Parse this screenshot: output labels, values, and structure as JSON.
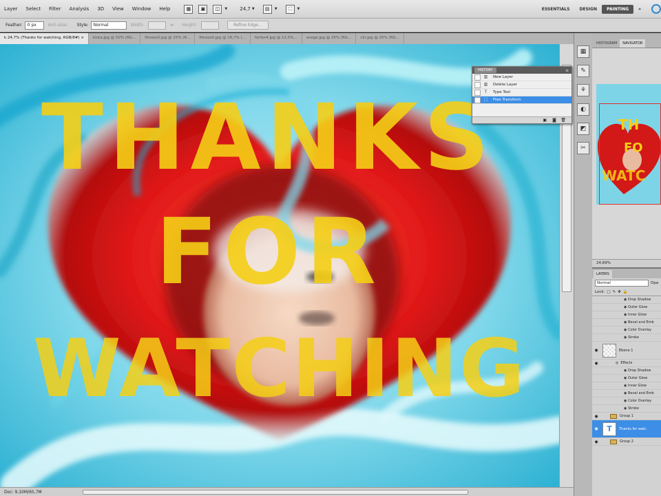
{
  "menu": [
    "Layer",
    "Select",
    "Filter",
    "Analysis",
    "3D",
    "View",
    "Window",
    "Help"
  ],
  "toolbar": {
    "zoom": "24,7"
  },
  "workspaces": [
    "ESSENTIALS",
    "DESIGN",
    "PAINTING"
  ],
  "active_workspace": "PAINTING",
  "options_bar": {
    "feather_label": "Feather:",
    "feather_value": "0 px",
    "anti_alias": "Anti-alias",
    "style_label": "Style:",
    "style_value": "Normal",
    "width_label": "Width:",
    "height_label": "Height:",
    "refine_edge": "Refine Edge..."
  },
  "document_tabs": [
    "k 24,7% (Thanks for watching, RGB/8#) ×",
    "kiota.jpg @ 50% (RG...",
    "fitness0.jpg @ 25% (R...",
    "fitness0.jpg @ 16,7% (...",
    "fortkn4.jpg @ 12,5%...",
    "avege.jpg @ 25% (RG...",
    "cln.jpg @ 25% (RG..."
  ],
  "canvas_text": {
    "line1": "THANKS",
    "line2": "FOR",
    "line3": "WATCHING"
  },
  "colors": {
    "text_yellow": "#f5cf16",
    "heart_red": "#d81616",
    "sky_cyan": "#6ecbe0",
    "selection_blue": "#3d8ee6"
  },
  "history": {
    "tab": "HISTORY",
    "items": [
      {
        "label": "New Layer",
        "icon": "layer-icon",
        "active": false
      },
      {
        "label": "Delete Layer",
        "icon": "layer-icon",
        "active": false
      },
      {
        "label": "Type Tool",
        "icon": "type-icon",
        "active": false
      },
      {
        "label": "Free Transform",
        "icon": "transform-icon",
        "active": true
      }
    ]
  },
  "navigator": {
    "tabs": [
      "HISTOGRAM",
      "NAVIGATOR"
    ],
    "active_tab": "NAVIGATOR",
    "zoom": "24,69%"
  },
  "layers_panel": {
    "tab": "LAYERS",
    "blend_mode": "Normal",
    "opacity_label": "Opa",
    "lock_label": "Lock:",
    "rows": [
      {
        "kind": "fx",
        "label": "Drop Shadow"
      },
      {
        "kind": "fx",
        "label": "Outer Glow"
      },
      {
        "kind": "fx",
        "label": "Inner Glow"
      },
      {
        "kind": "fx",
        "label": "Bevel and Emb"
      },
      {
        "kind": "fx",
        "label": "Color Overlay"
      },
      {
        "kind": "fx",
        "label": "Stroke"
      },
      {
        "kind": "layer",
        "label": "Ebene 1"
      },
      {
        "kind": "effects",
        "label": "Effects"
      },
      {
        "kind": "fx",
        "label": "Drop Shadow"
      },
      {
        "kind": "fx",
        "label": "Outer Glow"
      },
      {
        "kind": "fx",
        "label": "Inner Glow"
      },
      {
        "kind": "fx",
        "label": "Bevel and Emb"
      },
      {
        "kind": "fx",
        "label": "Color Overlay"
      },
      {
        "kind": "fx",
        "label": "Stroke"
      },
      {
        "kind": "group",
        "label": "Group 1"
      },
      {
        "kind": "text",
        "label": "Thanks for watc"
      },
      {
        "kind": "group",
        "label": "Group 2"
      }
    ]
  },
  "status": {
    "doc_size": "Doc: 9,10M/65,7M"
  }
}
